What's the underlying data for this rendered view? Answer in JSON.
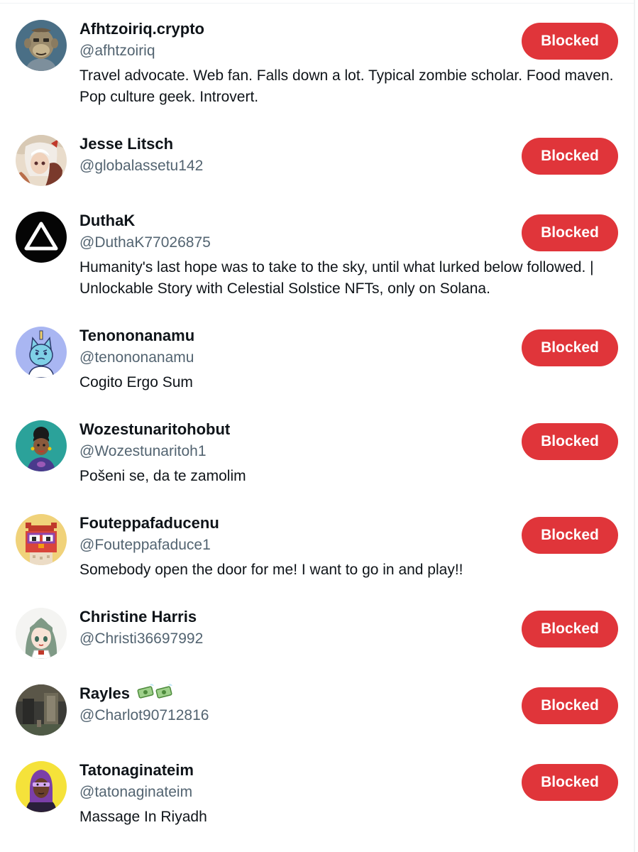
{
  "colors": {
    "blocked_button": "#e0353a",
    "handle_text": "#536471",
    "primary_text": "#0f1419",
    "divider": "#eff3f4"
  },
  "users": [
    {
      "display_name": "Afhtzoiriq.crypto",
      "handle": "@afhtzoiriq",
      "bio": "Travel advocate. Web fan. Falls down a lot. Typical zombie scholar. Food maven. Pop culture geek. Introvert.",
      "button_label": "Blocked",
      "avatar_icon": "bored-ape-avatar"
    },
    {
      "display_name": "Jesse Litsch",
      "handle": "@globalassetu142",
      "bio": "",
      "button_label": "Blocked",
      "avatar_icon": "anime-art-avatar"
    },
    {
      "display_name": "DuthaK",
      "handle": "@DuthaK77026875",
      "bio": "Humanity's last hope was to take to the sky, until what lurked below followed. | Unlockable Story with Celestial Solstice NFTs, only on Solana.",
      "button_label": "Blocked",
      "avatar_icon": "white-triangle-avatar"
    },
    {
      "display_name": "Tenononanamu",
      "handle": "@tenononanamu",
      "bio": "Cogito Ergo Sum",
      "button_label": "Blocked",
      "avatar_icon": "cartoon-cat-avatar"
    },
    {
      "display_name": "Wozestunaritohobut",
      "handle": "@Wozestunaritoh1",
      "bio": "Pošeni se, da te zamolim",
      "button_label": "Blocked",
      "avatar_icon": "illustrated-woman-avatar"
    },
    {
      "display_name": "Fouteppafaducenu",
      "handle": "@Fouteppafaduce1",
      "bio": "Somebody open the door for me! I want to go in and play!!",
      "button_label": "Blocked",
      "avatar_icon": "pixel-owl-avatar"
    },
    {
      "display_name": "Christine Harris",
      "handle": "@Christi36697992",
      "bio": "",
      "button_label": "Blocked",
      "avatar_icon": "anime-girl-avatar"
    },
    {
      "display_name": "Rayles",
      "name_emoji": "money-with-wings-emoji",
      "handle": "@Charlot90712816",
      "bio": "",
      "button_label": "Blocked",
      "avatar_icon": "dark-photo-avatar"
    },
    {
      "display_name": "Tatonaginateim",
      "handle": "@tatonaginateim",
      "bio": "Massage In Riyadh",
      "button_label": "Blocked",
      "avatar_icon": "illustrated-person-avatar"
    }
  ]
}
